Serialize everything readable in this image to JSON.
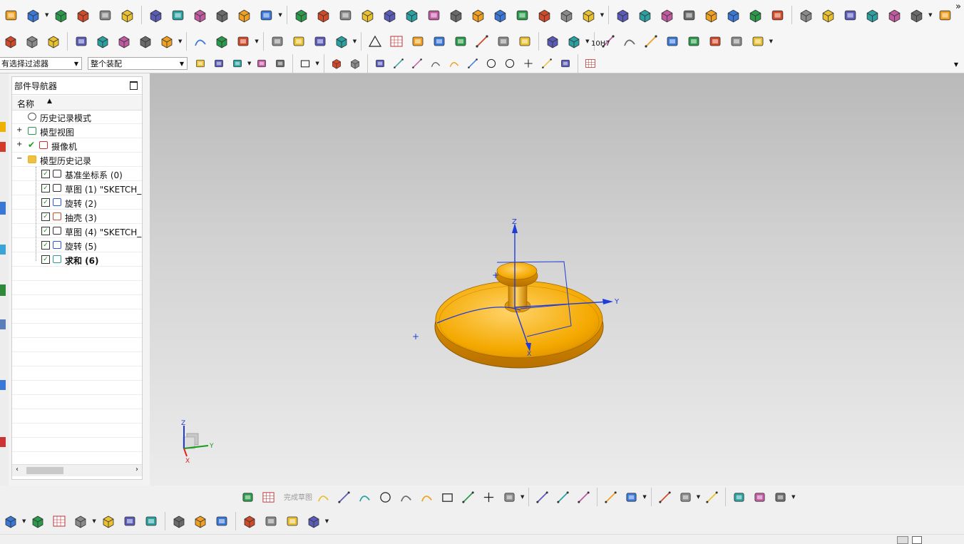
{
  "filters": {
    "selection_filter": "有选择过滤器",
    "scope": "整个装配"
  },
  "navigator": {
    "title": "部件导航器",
    "column_name": "名称",
    "items": [
      {
        "label": "历史记录模式",
        "level": 0
      },
      {
        "label": "模型视图",
        "level": 0
      },
      {
        "label": "摄像机",
        "level": 0
      },
      {
        "label": "模型历史记录",
        "level": 0
      },
      {
        "label": "基准坐标系 (0)",
        "level": 1
      },
      {
        "label": "草图 (1) \"SKETCH_(",
        "level": 1
      },
      {
        "label": "旋转 (2)",
        "level": 1
      },
      {
        "label": "抽壳 (3)",
        "level": 1
      },
      {
        "label": "草图 (4) \"SKETCH_(",
        "level": 1
      },
      {
        "label": "旋转 (5)",
        "level": 1
      },
      {
        "label": "求和 (6)",
        "level": 1
      }
    ]
  },
  "toolbar": {
    "fit_tolerance": "10H7",
    "finish_sketch": "完成草图",
    "more": "»"
  },
  "viewport": {
    "axis_z": "Z",
    "axis_y": "Y",
    "axis_x": "X",
    "model_color": "#f3a300"
  },
  "triad": {
    "z": "Z",
    "y": "Y",
    "x": "X"
  }
}
